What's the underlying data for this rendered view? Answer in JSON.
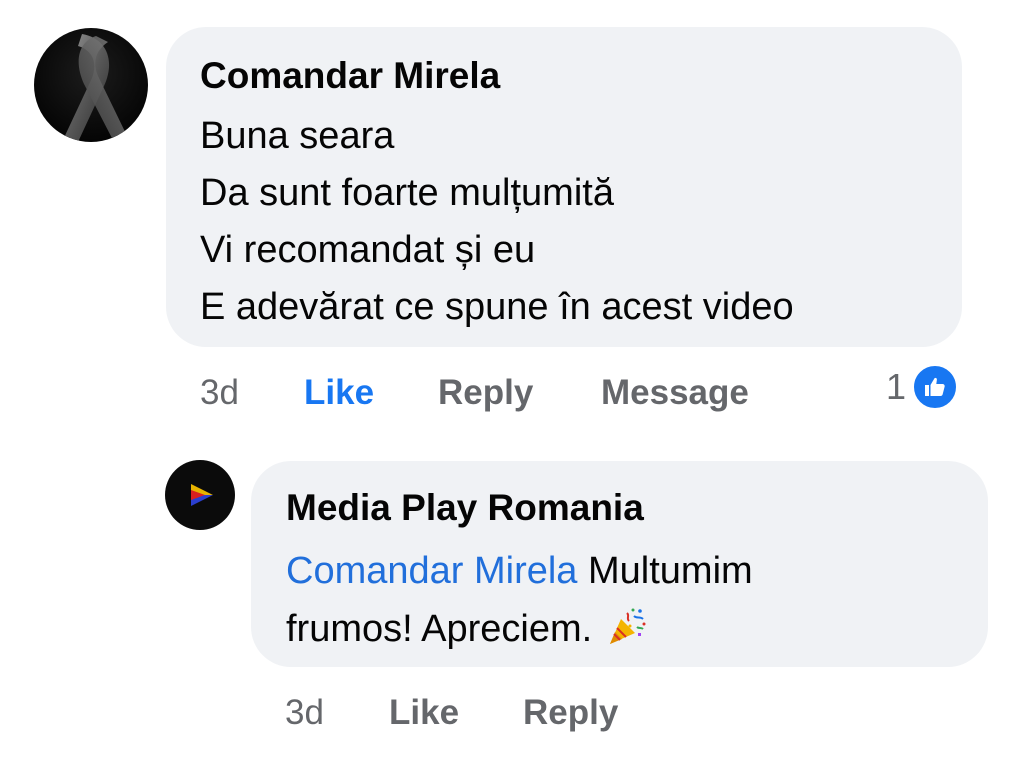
{
  "comment": {
    "author": "Comandar Mirela",
    "lines": [
      "Buna seara",
      "Da sunt foarte mulțumită",
      "Vi recomandat și eu",
      "E adevărat ce spune în acest video"
    ],
    "time": "3d",
    "actions": {
      "like": "Like",
      "reply": "Reply",
      "message": "Message"
    },
    "reaction_count": "1",
    "reaction_icon": "like-thumb-icon",
    "like_active_color": "#1877f2"
  },
  "reply": {
    "author": "Media Play Romania",
    "mention": "Comandar Mirela",
    "text_after_mention": " Multumim",
    "text_line2": "frumos! Apreciem.",
    "emoji_icon": "party-popper-icon",
    "time": "3d",
    "actions": {
      "like": "Like",
      "reply": "Reply"
    }
  },
  "colors": {
    "bubble_bg": "#f0f2f5",
    "meta_text": "#65676b",
    "mention": "#216fdb",
    "accent": "#1877f2"
  }
}
